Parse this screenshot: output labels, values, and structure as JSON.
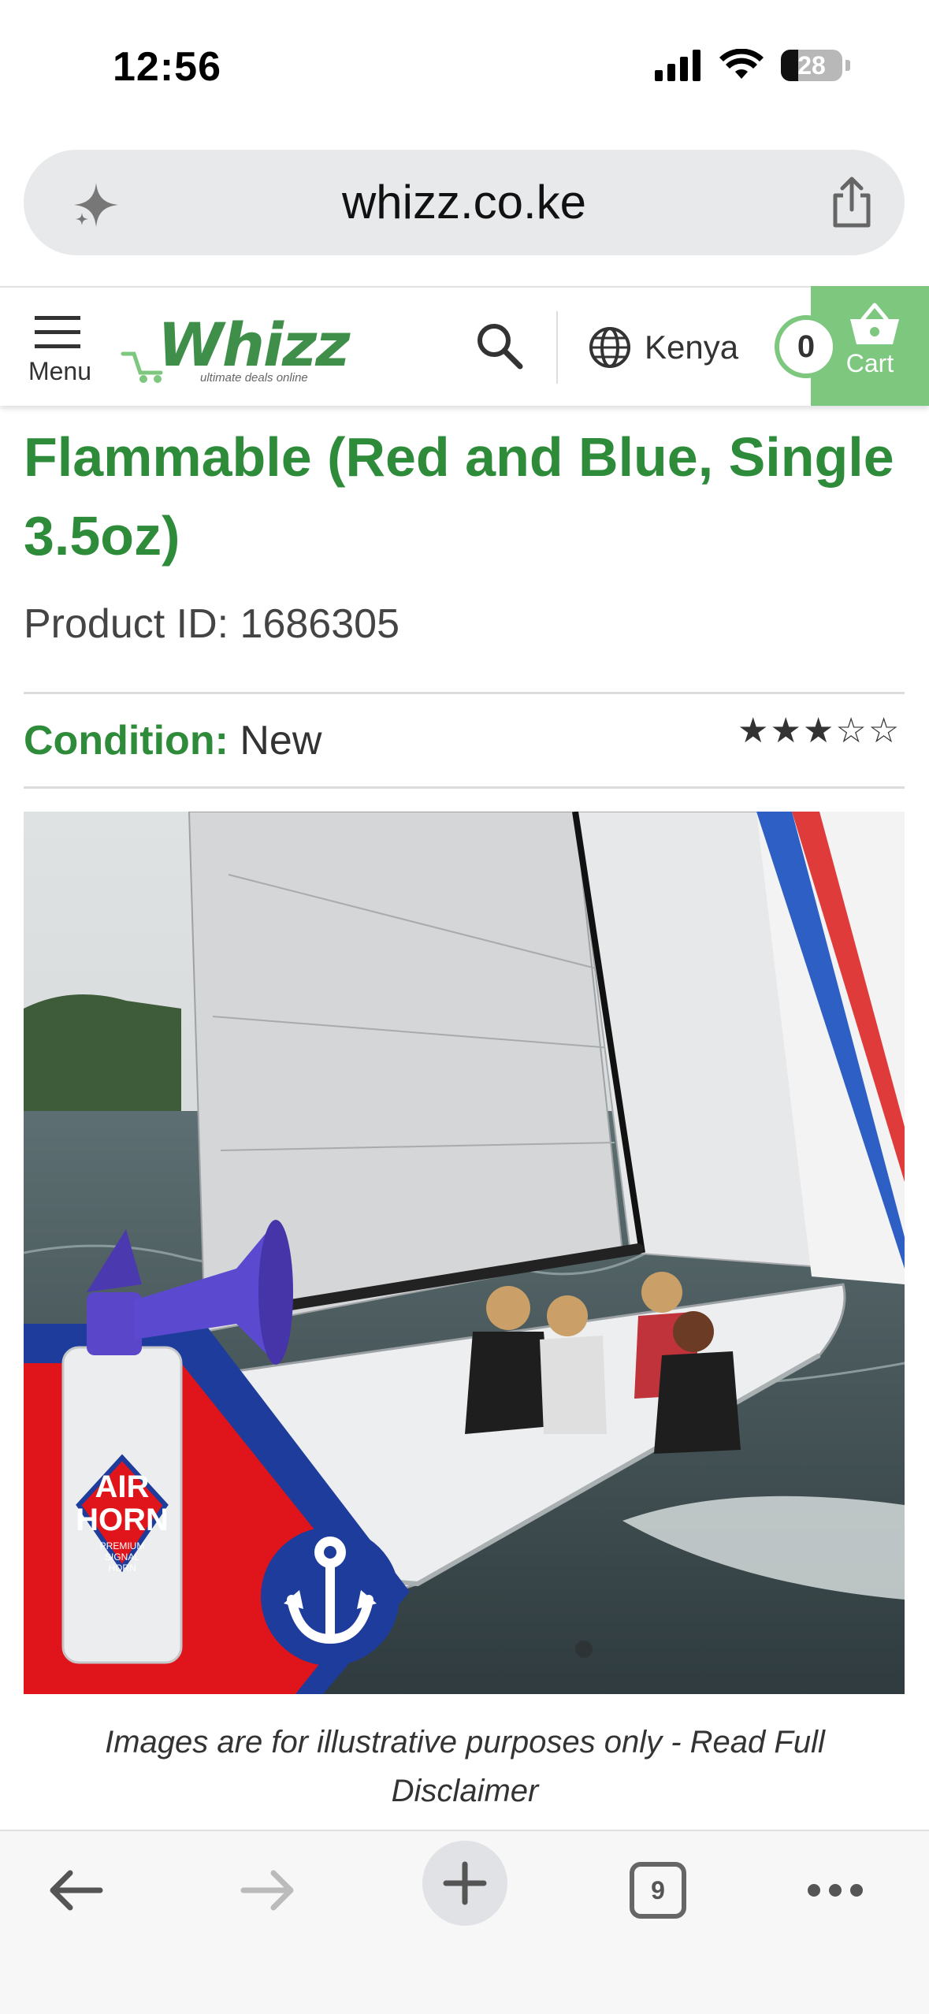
{
  "status_bar": {
    "time": "12:56",
    "battery": "28"
  },
  "browser": {
    "url": "whizz.co.ke",
    "tab_count": "9"
  },
  "header": {
    "menu_label": "Menu",
    "logo_text": "Whizz",
    "logo_tagline": "ultimate deals online",
    "country": "Kenya",
    "cart_count": "0",
    "cart_label": "Cart"
  },
  "product": {
    "title": "Flammable (Red and Blue, Single 3.5oz)",
    "product_id": "Product ID: 1686305",
    "condition_label": "Condition:",
    "condition_value": "New",
    "rating": 3,
    "rating_max": 5,
    "image": {
      "horn_brand_line1": "AIR",
      "horn_brand_line2": "HORN",
      "horn_sub1": "PREMIUM",
      "horn_sub2": "SIGNAL",
      "horn_sub3": "HORN"
    },
    "disclaimer": "Images are for illustrative purposes only - Read Full Disclaimer"
  },
  "colors": {
    "brand_green": "#2e8b3a",
    "cart_green": "#7dc77f",
    "horn_red": "#e0151b",
    "horn_blue": "#1d3c9c"
  },
  "icons": [
    "sparkle-icon",
    "share-icon",
    "menu-icon",
    "search-icon",
    "globe-icon",
    "cart-icon",
    "back-icon",
    "forward-icon",
    "plus-icon",
    "tabs-icon",
    "more-icon"
  ]
}
